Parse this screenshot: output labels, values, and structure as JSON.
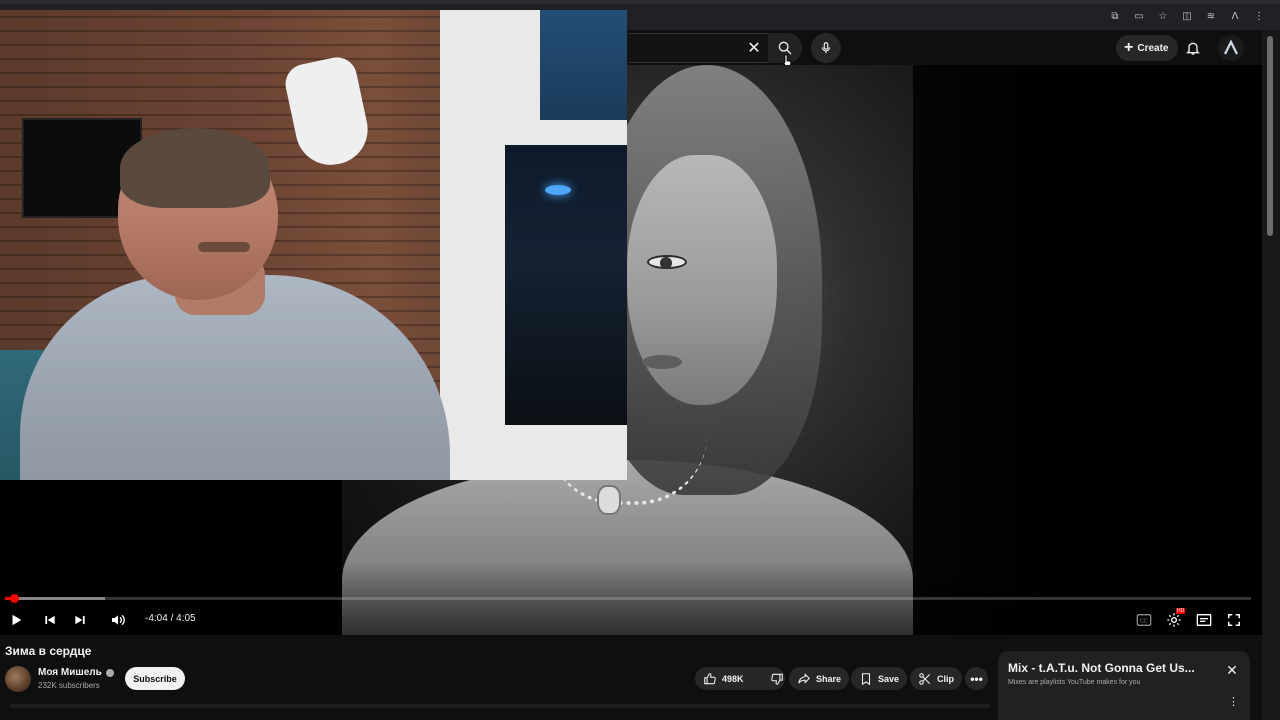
{
  "header": {
    "search_clear_icon": "close-icon",
    "search_icon": "search-icon",
    "mic_icon": "microphone-icon",
    "create_label": "Create",
    "create_icon": "plus-icon",
    "notifications_icon": "bell-icon",
    "avatar_icon": "account-avatar"
  },
  "browser": {
    "toolbar_icons": [
      "open-in-new-icon",
      "cast-icon",
      "star-icon",
      "extensions-icon",
      "translate-icon",
      "profile-icon",
      "menu-icon"
    ]
  },
  "player": {
    "time": "-4:04 / 4:05",
    "progress_played": 0.004,
    "progress_loaded": 0.08,
    "controls_left": [
      "play-icon",
      "previous-icon",
      "next-icon",
      "volume-icon"
    ],
    "controls_right": [
      "captions-icon",
      "settings-icon",
      "miniplayer-icon",
      "fullscreen-icon"
    ],
    "settings_badge": "HD"
  },
  "video": {
    "title": "Зима в сердце",
    "channel_name": "Моя Мишель",
    "subscribers": "232K subscribers",
    "subscribe_label": "Subscribe",
    "likes": "498K",
    "share_label": "Share",
    "save_label": "Save",
    "clip_label": "Clip",
    "more_label": "•••"
  },
  "mix_card": {
    "title": "Mix - t.A.T.u. Not Gonna Get Us...",
    "subtitle": "Mixes are playlists YouTube makes for you",
    "close_icon": "close-icon"
  },
  "colors": {
    "background": "#0f0f0f",
    "accent_red": "#ff0000",
    "pill_bg": "#272727",
    "subscribe_bg": "#f1f1f1"
  }
}
